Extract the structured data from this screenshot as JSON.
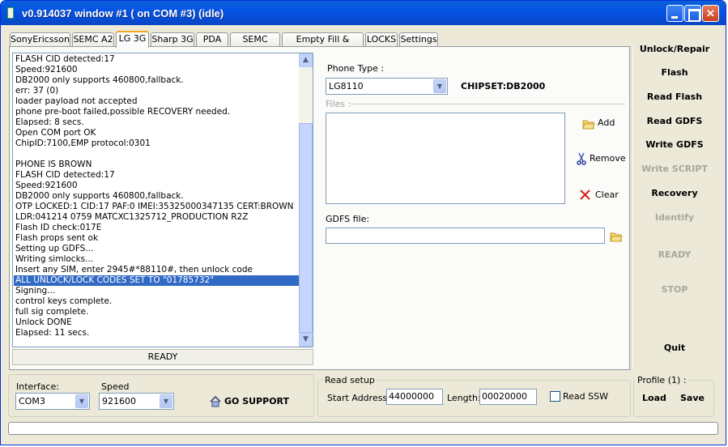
{
  "window": {
    "title": "v0.914037 window #1 ( on COM #3) (idle)"
  },
  "tabs": [
    {
      "label": "SonyEricsson"
    },
    {
      "label": "SEMC A2"
    },
    {
      "label": "LG 3G"
    },
    {
      "label": "Sharp 3G"
    },
    {
      "label": "PDA"
    },
    {
      "label": "SEMC ODM"
    },
    {
      "label": "Empty Fill & Repair"
    },
    {
      "label": "LOCKS"
    },
    {
      "label": "Settings"
    }
  ],
  "active_tab": "LG 3G",
  "log": {
    "lines": [
      "FLASH CID detected:17",
      "Speed:921600",
      "DB2000 only supports 460800,fallback.",
      "err: 37 (0)",
      "loader payload not accepted",
      "phone pre-boot failed,possible RECOVERY needed.",
      "Elapsed: 8 secs.",
      "Open COM port OK",
      "ChipID:7100,EMP protocol:0301",
      "",
      "PHONE IS BROWN",
      "FLASH CID detected:17",
      "Speed:921600",
      "DB2000 only supports 460800,fallback.",
      "OTP LOCKED:1 CID:17 PAF:0 IMEI:35325000347135 CERT:BROWN",
      "LDR:041214 0759 MATCXC1325712_PRODUCTION R2Z",
      "Flash ID check:017E",
      "Flash props sent ok",
      "Setting up GDFS...",
      "Writing simlocks...",
      "Insert any SIM, enter 2945#*88110#, then unlock code",
      "ALL UNLOCK/LOCK CODES SET TO \"01785732\"",
      "Signing...",
      "control keys complete.",
      "full sig complete.",
      "Unlock DONE",
      "Elapsed: 11 secs."
    ],
    "selected_index": 21
  },
  "log_status": "READY",
  "phone": {
    "type_label": "Phone Type :",
    "type_value": "LG8110",
    "chipset": "CHIPSET:DB2000",
    "files_label": "Files :",
    "add_label": "Add",
    "remove_label": "Remove",
    "clear_label": "Clear",
    "gdfs_label": "GDFS file:",
    "gdfs_value": ""
  },
  "side": {
    "unlock": "Unlock/Repair",
    "flash": "Flash",
    "read_flash": "Read Flash",
    "read_gdfs": "Read GDFS",
    "write_gdfs": "Write GDFS",
    "write_script": "Write SCRIPT",
    "recovery": "Recovery",
    "identify": "Identify",
    "ready": "READY",
    "stop": "STOP",
    "quit": "Quit"
  },
  "bottom": {
    "interface_label": "Interface:",
    "interface_value": "COM3",
    "speed_label": "Speed",
    "speed_value": "921600",
    "go_support": "GO SUPPORT",
    "read_setup_label": "Read setup",
    "start_address_label": "Start Address:",
    "start_address_value": "44000000",
    "length_label": "Length:",
    "length_value": "00020000",
    "read_ssw_label": "Read SSW",
    "profile_label": "Profile (1) :",
    "load": "Load",
    "save": "Save"
  },
  "colors": {
    "title_bar": "#0454e6",
    "selection": "#316ac5",
    "window_bg": "#ece9d8"
  }
}
